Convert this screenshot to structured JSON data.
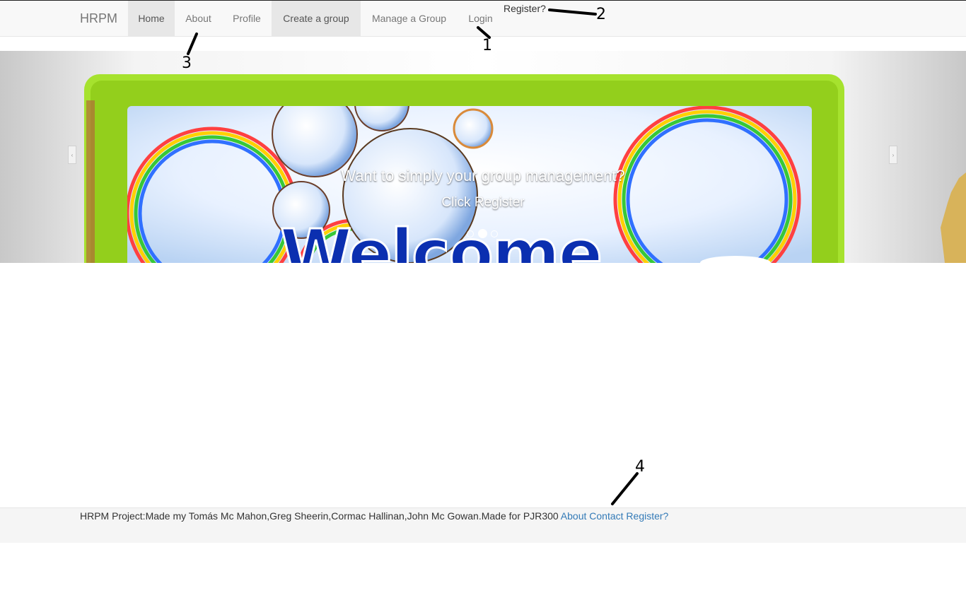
{
  "brand": "HRPM",
  "nav": {
    "items": [
      {
        "label": "Home",
        "active": true
      },
      {
        "label": "About",
        "active": false
      },
      {
        "label": "Profile",
        "active": false
      },
      {
        "label": "Create a group",
        "active": true
      },
      {
        "label": "Manage a Group",
        "active": false
      },
      {
        "label": "Login",
        "active": false
      }
    ],
    "register": "Register?"
  },
  "carousel": {
    "caption_title": "Want to simply your group management?",
    "caption_sub": "Click Register",
    "image_text": "Welcome",
    "active_slide": 2,
    "slide_count": 3,
    "prev_icon": "chevron-left-icon",
    "next_icon": "chevron-right-icon"
  },
  "annotations": [
    "1",
    "2",
    "3",
    "4"
  ],
  "footer": {
    "text": "HRPM Project:Made my Tomás Mc Mahon,Greg Sheerin,Cormac Hallinan,John Mc Gowan.Made for PJR300 ",
    "links": [
      "About",
      "Contact",
      "Register?"
    ]
  },
  "colors": {
    "navbar_bg": "#f8f8f8",
    "nav_active_bg": "#e7e7e7",
    "link": "#337ab7",
    "frame_green": "#a6e22e"
  }
}
